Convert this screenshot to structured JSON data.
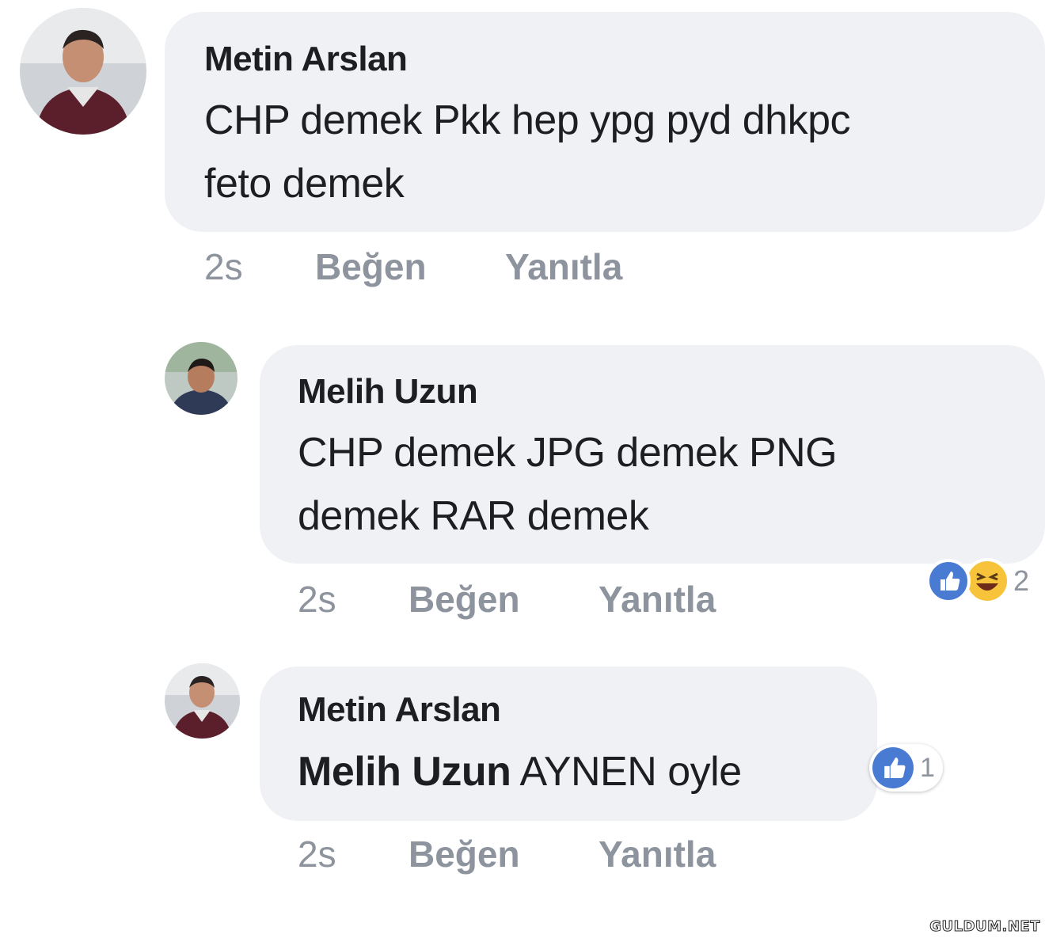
{
  "comments": [
    {
      "author": "Metin Arslan",
      "text_line1": "CHP demek Pkk hep ypg pyd dhkpc",
      "text_line2": "feto demek",
      "time": "2s",
      "like_label": "Beğen",
      "reply_label": "Yanıtla"
    },
    {
      "author": "Melih Uzun",
      "text_line1": "CHP demek JPG demek PNG",
      "text_line2": "demek RAR demek",
      "time": "2s",
      "like_label": "Beğen",
      "reply_label": "Yanıtla",
      "reactions": [
        "like-icon",
        "haha-icon"
      ],
      "reaction_count": "2"
    },
    {
      "author": "Metin Arslan",
      "mention": "Melih Uzun",
      "text": "AYNEN oyle",
      "time": "2s",
      "like_label": "Beğen",
      "reply_label": "Yanıtla",
      "reactions": [
        "like-icon"
      ],
      "reaction_count": "1"
    }
  ],
  "colors": {
    "bubble": "#f0f1f4",
    "meta_text": "#8d949e",
    "like_blue": "#4a7bd3",
    "haha_yellow": "#f6c33b"
  },
  "watermark": "GULDUM.NET"
}
